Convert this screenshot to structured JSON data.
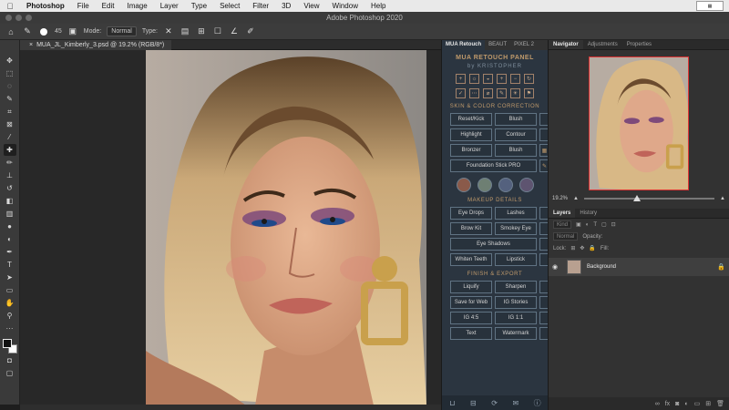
{
  "menubar": {
    "apple": "",
    "items": [
      "Photoshop",
      "File",
      "Edit",
      "Image",
      "Layer",
      "Type",
      "Select",
      "Filter",
      "3D",
      "View",
      "Window",
      "Help"
    ]
  },
  "titlebar": {
    "title": "Adobe Photoshop 2020"
  },
  "options": {
    "brush_size": "45",
    "mode_label": "Mode:",
    "mode_value": "Normal",
    "type_label": "Type:"
  },
  "document": {
    "tab_title": "MUA_JL_Kimberly_3.psd @ 19.2% (RGB/8*)"
  },
  "mua": {
    "tabs": [
      "MUA Retouch",
      "BEAUT",
      "PIXEL 2"
    ],
    "title": "MUA RETOUCH PANEL",
    "subtitle": "by KRISTOPHER",
    "sections": {
      "skin": "SKIN & COLOR CORRECTION",
      "makeup": "MAKEUP DETAILS",
      "finish": "FINISH & EXPORT"
    },
    "skin_buttons": [
      "Reset/Kick",
      "Blush",
      "Highlight",
      "Contour",
      "Bronzer",
      "Blush",
      "Foundation Stick PRO"
    ],
    "makeup_buttons": [
      "Eye Drops",
      "Lashes",
      "Brow Kit",
      "Smokey Eye",
      "Eye Shadows",
      "Whiten Teeth",
      "Lipstick"
    ],
    "finish_buttons": [
      "Liquify",
      "Sharpen",
      "Save for Web",
      "IG Stories",
      "IG 4:5",
      "IG 1:1",
      "Text",
      "Watermark"
    ],
    "swatches": [
      "#8a5a4a",
      "#6e7f73",
      "#54617e",
      "#5e5470"
    ]
  },
  "navigator": {
    "tabs": [
      "Navigator",
      "Adjustments",
      "Properties"
    ],
    "zoom": "19.2%"
  },
  "layers": {
    "tabs": [
      "Layers",
      "History"
    ],
    "kind_placeholder": "Kind",
    "blend_mode": "Normal",
    "opacity_label": "Opacity:",
    "lock_label": "Lock:",
    "fill_label": "Fill:",
    "layer_name": "Background"
  }
}
